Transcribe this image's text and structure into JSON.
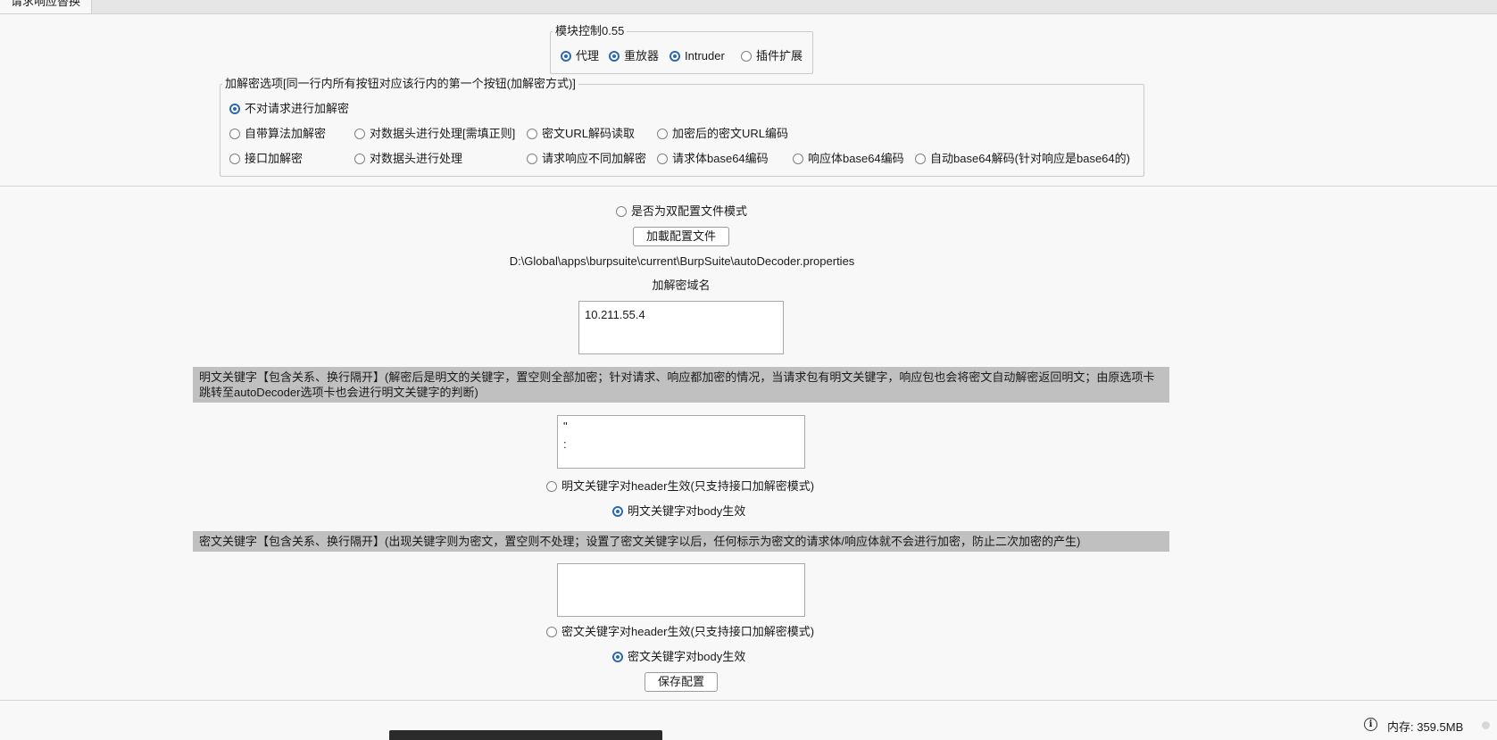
{
  "tab": {
    "label": "请求响应替换"
  },
  "module_control": {
    "legend": "模块控制0.55",
    "options": [
      {
        "label": "代理",
        "checked": true
      },
      {
        "label": "重放器",
        "checked": true
      },
      {
        "label": "Intruder",
        "checked": true
      },
      {
        "label": "插件扩展",
        "checked": false
      }
    ]
  },
  "crypto_options": {
    "legend": "加解密选项[同一行内所有按钮对应该行内的第一个按钮(加解密方式)]",
    "row0": [
      {
        "label": "不对请求进行加解密",
        "checked": true
      }
    ],
    "row1": [
      {
        "label": "自带算法加解密",
        "checked": false
      },
      {
        "label": "对数据头进行处理[需填正则]",
        "checked": false
      },
      {
        "label": "密文URL解码读取",
        "checked": false
      },
      {
        "label": "加密后的密文URL编码",
        "checked": false
      }
    ],
    "row2": [
      {
        "label": "接口加解密",
        "checked": false
      },
      {
        "label": "对数据头进行处理",
        "checked": false
      },
      {
        "label": "请求响应不同加解密",
        "checked": false
      },
      {
        "label": "请求体base64编码",
        "checked": false
      },
      {
        "label": "响应体base64编码",
        "checked": false
      },
      {
        "label": "自动base64解码(针对响应是base64的)",
        "checked": false
      }
    ]
  },
  "config": {
    "dual_mode_label": "是否为双配置文件模式",
    "dual_mode_checked": false,
    "load_button": "加載配置文件",
    "file_path": "D:\\Global\\apps\\burpsuite\\current\\BurpSuite\\autoDecoder.properties",
    "domain_label": "加解密域名",
    "domain_value": "10.211.55.4"
  },
  "plaintext_keywords": {
    "banner_line1": "明文关键字【包含关系、换行隔开】(解密后是明文的关键字，置空则全部加密；针对请求、响应都加密的情况，当请求包有明文关键字，响应包也会将密文自动解密返回明文；由原选项卡",
    "banner_line2": "跳转至autoDecoder选项卡也会进行明文关键字的判断)",
    "value": "\"\n:",
    "header_option": {
      "label": "明文关键字对header生效(只支持接口加解密模式)",
      "checked": false
    },
    "body_option": {
      "label": "明文关键字对body生效",
      "checked": true
    }
  },
  "ciphertext_keywords": {
    "banner": "密文关键字【包含关系、换行隔开】(出现关键字则为密文，置空则不处理；设置了密文关键字以后，任何标示为密文的请求体/响应体就不会进行加密，防止二次加密的产生)",
    "value": "",
    "header_option": {
      "label": "密文关键字对header生效(只支持接口加解密模式)",
      "checked": false
    },
    "body_option": {
      "label": "密文关键字对body生效",
      "checked": true
    }
  },
  "save_button": "保存配置",
  "status_bar": {
    "memory": "内存: 359.5MB",
    "icon": "info-icon"
  },
  "colors": {
    "accent": "#2c69b0",
    "banner_bg": "#c0c0c0",
    "background": "#f8f8f8"
  }
}
